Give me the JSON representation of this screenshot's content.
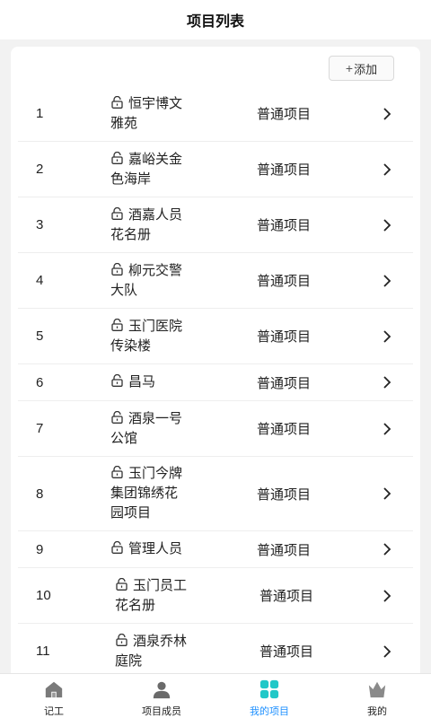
{
  "header": {
    "title": "项目列表"
  },
  "toolbar": {
    "add_label": "添加",
    "add_icon": "plus-icon"
  },
  "projects": [
    {
      "index": "1",
      "name_line1": "恒宇博文",
      "name_line2": "雅苑",
      "name_line3": "",
      "type": "普通项目"
    },
    {
      "index": "2",
      "name_line1": "嘉峪关金",
      "name_line2": "色海岸",
      "name_line3": "",
      "type": "普通项目"
    },
    {
      "index": "3",
      "name_line1": "酒嘉人员",
      "name_line2": "花名册",
      "name_line3": "",
      "type": "普通项目"
    },
    {
      "index": "4",
      "name_line1": "柳元交警",
      "name_line2": "大队",
      "name_line3": "",
      "type": "普通项目"
    },
    {
      "index": "5",
      "name_line1": "玉门医院",
      "name_line2": "传染楼",
      "name_line3": "",
      "type": "普通项目"
    },
    {
      "index": "6",
      "name_line1": "昌马",
      "name_line2": "",
      "name_line3": "",
      "type": "普通项目"
    },
    {
      "index": "7",
      "name_line1": "酒泉一号",
      "name_line2": "公馆",
      "name_line3": "",
      "type": "普通项目"
    },
    {
      "index": "8",
      "name_line1": "玉门今牌",
      "name_line2": "集团锦绣花",
      "name_line3": "园项目",
      "type": "普通项目"
    },
    {
      "index": "9",
      "name_line1": "管理人员",
      "name_line2": "",
      "name_line3": "",
      "type": "普通项目"
    },
    {
      "index": "10",
      "name_line1": "玉门员工",
      "name_line2": "花名册",
      "name_line3": "",
      "type": "普通项目"
    },
    {
      "index": "11",
      "name_line1": "酒泉乔林",
      "name_line2": "庭院",
      "name_line3": "",
      "type": "普通项目"
    }
  ],
  "tabbar": {
    "items": [
      {
        "label": "记工",
        "icon": "house-icon"
      },
      {
        "label": "项目成员",
        "icon": "person-icon"
      },
      {
        "label": "我的项目",
        "icon": "grid-icon",
        "active": true
      },
      {
        "label": "我的",
        "icon": "crown-icon"
      }
    ],
    "active_color": "#1e90ff",
    "active_icon_color": "#21c8c8"
  }
}
